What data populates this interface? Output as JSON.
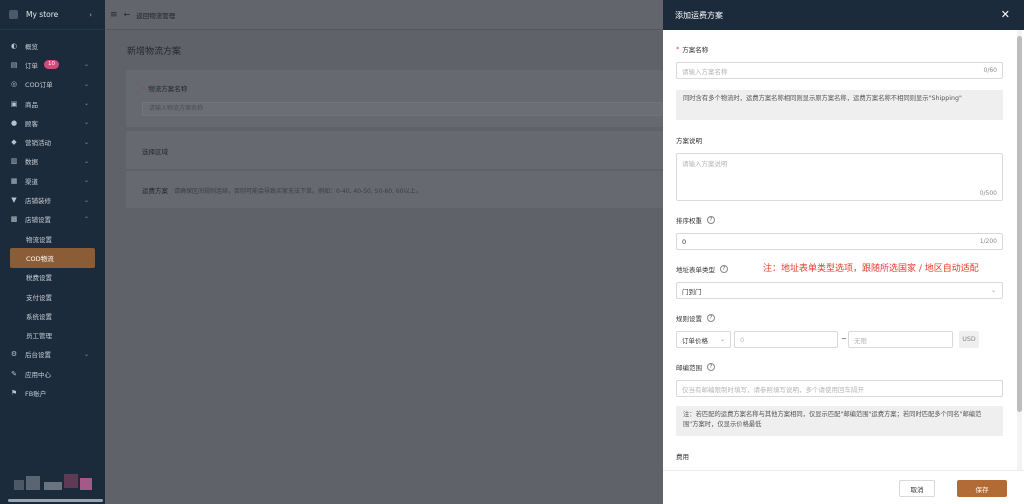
{
  "sidebar": {
    "store_name": "My store",
    "items": [
      {
        "label": "概览",
        "icon": "gauge-icon"
      },
      {
        "label": "订单",
        "icon": "order-icon",
        "badge": "10"
      },
      {
        "label": "COD订单",
        "icon": "cod-order-icon"
      },
      {
        "label": "商品",
        "icon": "product-icon"
      },
      {
        "label": "顾客",
        "icon": "customer-icon"
      },
      {
        "label": "营销活动",
        "icon": "marketing-icon"
      },
      {
        "label": "数据",
        "icon": "data-icon"
      },
      {
        "label": "渠道",
        "icon": "channel-icon"
      },
      {
        "label": "店铺装修",
        "icon": "decorate-icon"
      },
      {
        "label": "店铺设置",
        "icon": "store-settings-icon"
      }
    ],
    "sub_items": [
      {
        "label": "物流设置"
      },
      {
        "label": "COD物流"
      },
      {
        "label": "税费设置"
      },
      {
        "label": "支付设置"
      },
      {
        "label": "系统设置"
      },
      {
        "label": "员工管理"
      }
    ],
    "items_after": [
      {
        "label": "后台设置",
        "icon": "admin-settings-icon"
      },
      {
        "label": "应用中心",
        "icon": "app-center-icon"
      },
      {
        "label": "FB账户",
        "icon": "fb-account-icon"
      }
    ]
  },
  "main": {
    "back_label": "返回物流管理",
    "page_title": "新增物流方案",
    "name_label": "物流方案名称",
    "name_placeholder": "请输入物流方案名称",
    "region_label": "选择区域",
    "shipping_label": "运费方案",
    "shipping_hint": "请确保区间规则连续，否则可能会导致买家无法下单。例如：0-40, 40-50, 50-60, 60以上。"
  },
  "panel": {
    "title": "添加运费方案",
    "plan_name_label": "方案名称",
    "plan_name_placeholder": "请输入方案名称",
    "plan_name_count": "0/60",
    "plan_name_note": "同时含有多个物流时，运费方案名称相同则显示原方案名称，运费方案名称不相同则显示\"Shipping\"",
    "desc_label": "方案说明",
    "desc_placeholder": "请输入方案说明",
    "desc_count": "0/500",
    "sort_label": "排序权重",
    "sort_value": "0",
    "sort_count": "1/200",
    "address_type_label": "地址表单类型",
    "address_type_annotation": "注：地址表单类型选项，跟随所选国家 / 地区自动适配",
    "address_type_value": "门到门",
    "rule_label": "规则设置",
    "rule_type_value": "订单价格",
    "rule_min_placeholder": "0",
    "rule_tilde": "~",
    "rule_max_placeholder": "无限",
    "currency": "USD",
    "postcode_label": "邮编范围",
    "postcode_placeholder": "仅当有邮编限制时填写，请参照填写说明，多个请使用回车隔开",
    "postcode_note": "注：若匹配的运费方案名称与其他方案相同，仅显示匹配\"邮编范围\"运费方案；若同时匹配多个同名\"邮编范围\"方案时，仅显示价格最低",
    "fee_label": "费用",
    "cancel_label": "取消",
    "save_label": "保存"
  }
}
